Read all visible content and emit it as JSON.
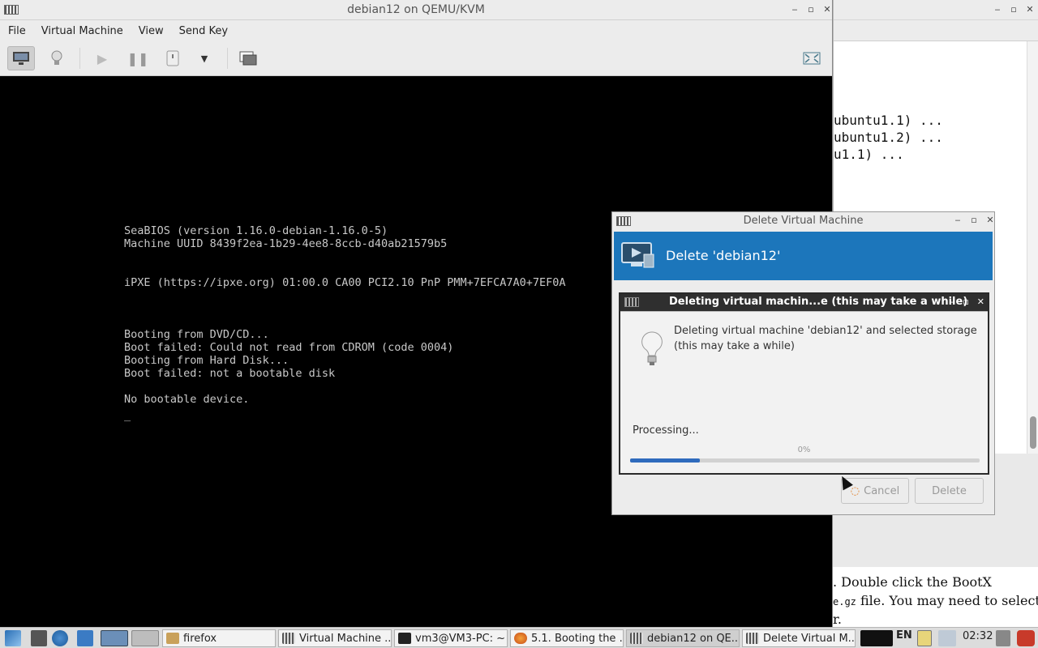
{
  "background_window": {
    "terminal_lines": [
      "ubuntu1.1) ...",
      "ubuntu1.2) ...",
      "u1.1) ..."
    ],
    "doc_line1": ". Double click the BootX",
    "doc_line2_code": "e.gz",
    "doc_line2_text": " file. You may need to select",
    "doc_line3": "r."
  },
  "main_window": {
    "title": "debian12 on QEMU/KVM",
    "menu": [
      "File",
      "Virtual Machine",
      "View",
      "Send Key"
    ],
    "toolbar_icons": [
      "monitor-icon",
      "lightbulb-icon",
      "play-icon",
      "pause-icon",
      "power-icon",
      "dropdown-icon",
      "snapshots-icon",
      "fullscreen-icon"
    ],
    "console": {
      "line1": "SeaBIOS (version 1.16.0-debian-1.16.0-5)",
      "line2": "Machine UUID 8439f2ea-1b29-4ee8-8ccb-d40ab21579b5",
      "line3": "iPXE (https://ipxe.org) 01:00.0 CA00 PCI2.10 PnP PMM+7EFCA7A0+7EF0A",
      "line4": "Booting from DVD/CD...",
      "line5": "Boot failed: Could not read from CDROM (code 0004)",
      "line6": "Booting from Hard Disk...",
      "line7": "Boot failed: not a bootable disk",
      "line8": "No bootable device.",
      "cursor": "_"
    }
  },
  "delete_dialog": {
    "title": "Delete Virtual Machine",
    "banner": "Delete 'debian12'",
    "cancel_label": "Cancel",
    "delete_label": "Delete"
  },
  "progress_dialog": {
    "title": "Deleting virtual machin...e (this may take a while)",
    "message": "Deleting virtual machine 'debian12' and selected storage (this may take a while)",
    "status": "Processing...",
    "percent_label": "0%",
    "progress_fraction": 0.2
  },
  "taskbar": {
    "tasks": [
      "firefox",
      "Virtual Machine ...",
      "vm3@VM3-PC: ~",
      "5.1. Booting the ...",
      "debian12 on QE...",
      "Delete Virtual M..."
    ],
    "language": "EN",
    "clock": "02:32"
  },
  "colors": {
    "banner": "#1c76bb",
    "progress": "#2f6bbd",
    "console_text": "#c8c8c8"
  }
}
